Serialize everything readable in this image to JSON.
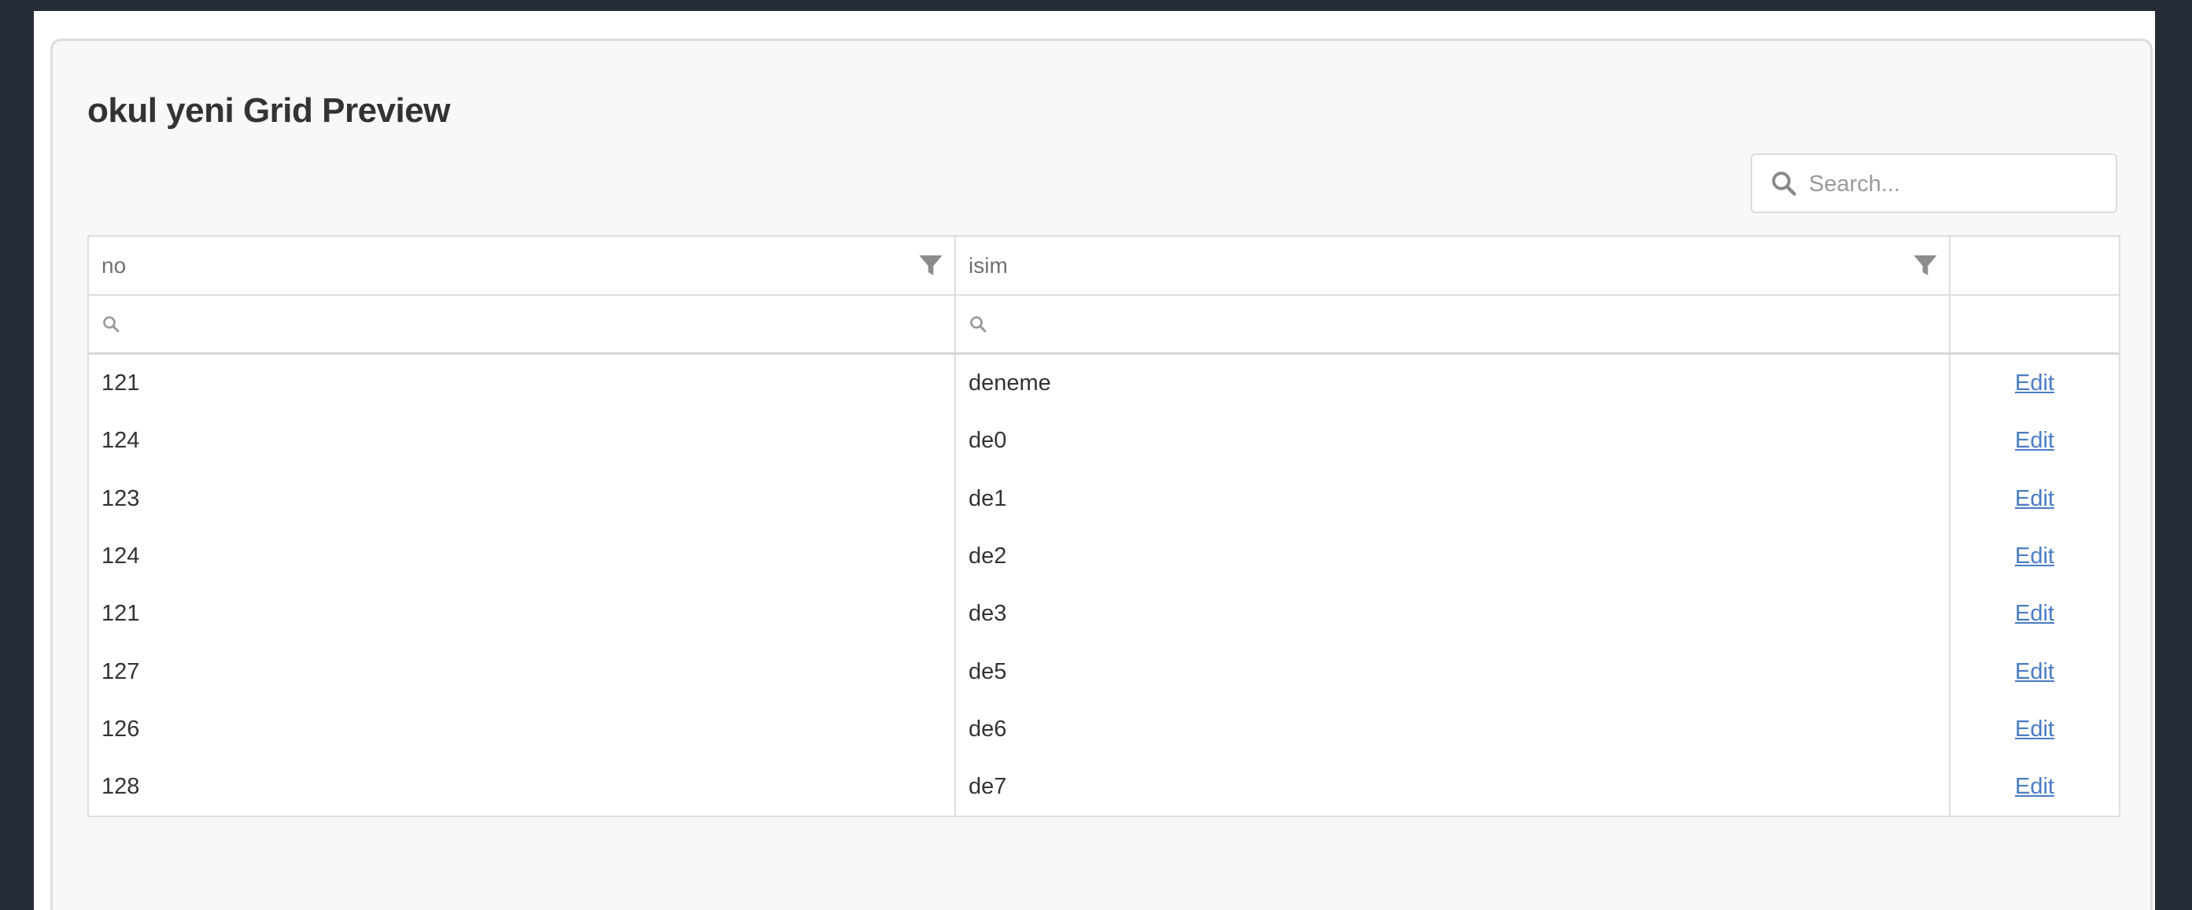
{
  "page": {
    "title": "okul yeni Grid Preview"
  },
  "search": {
    "placeholder": "Search..."
  },
  "grid": {
    "columns": [
      {
        "label": "no",
        "icon": "filter-icon"
      },
      {
        "label": "isim",
        "icon": "filter-icon"
      },
      {
        "label": ""
      }
    ],
    "rows": [
      {
        "no": "121",
        "isim": "deneme",
        "action": "Edit"
      },
      {
        "no": "124",
        "isim": "de0",
        "action": "Edit"
      },
      {
        "no": "123",
        "isim": "de1",
        "action": "Edit"
      },
      {
        "no": "124",
        "isim": "de2",
        "action": "Edit"
      },
      {
        "no": "121",
        "isim": "de3",
        "action": "Edit"
      },
      {
        "no": "127",
        "isim": "de5",
        "action": "Edit"
      },
      {
        "no": "126",
        "isim": "de6",
        "action": "Edit"
      },
      {
        "no": "128",
        "isim": "de7",
        "action": "Edit"
      }
    ]
  },
  "colors": {
    "background": "#262c36",
    "panel": "#f8f8f8",
    "link": "#4a7cc4"
  }
}
